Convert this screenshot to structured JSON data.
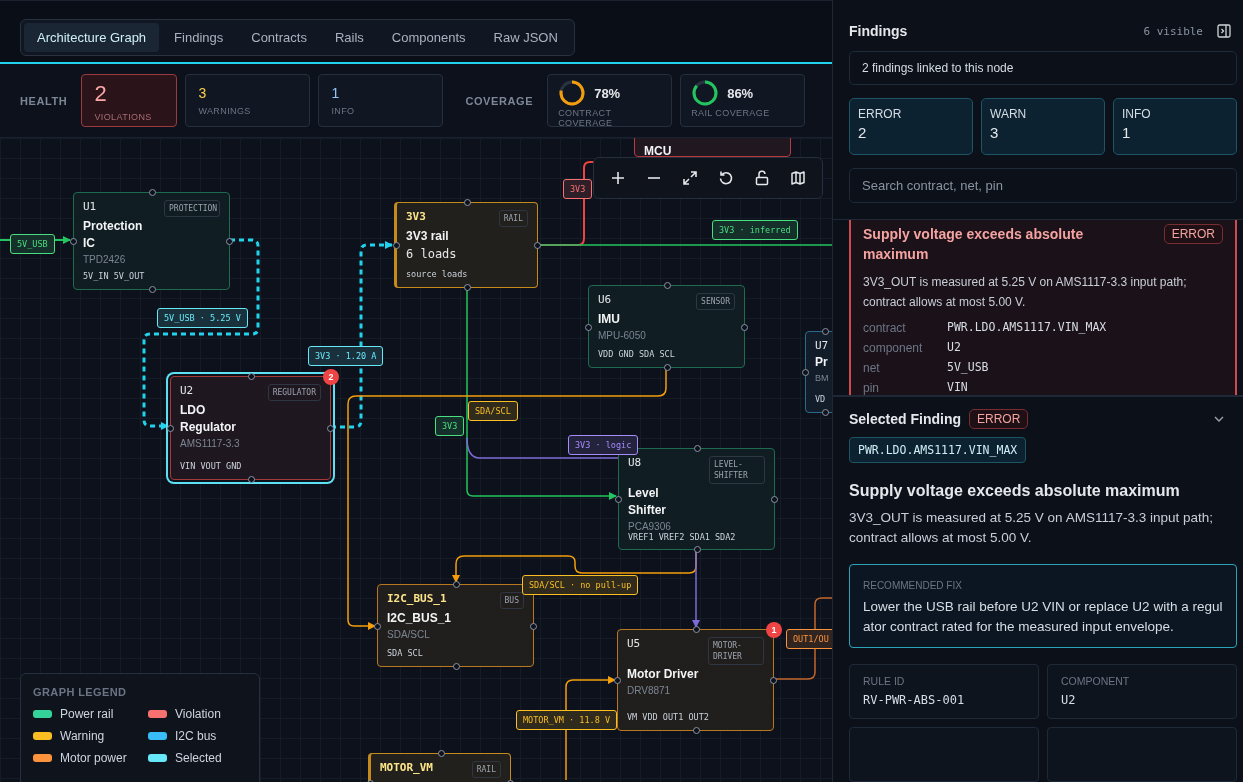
{
  "tabs": [
    {
      "label": "Architecture Graph",
      "selected": true
    },
    {
      "label": "Findings",
      "selected": false
    },
    {
      "label": "Contracts",
      "selected": false
    },
    {
      "label": "Rails",
      "selected": false
    },
    {
      "label": "Components",
      "selected": false
    },
    {
      "label": "Raw JSON",
      "selected": false
    }
  ],
  "health": {
    "label": "HEALTH",
    "cards": [
      {
        "kind": "violation",
        "value": "2",
        "label": "VIOLATIONS"
      },
      {
        "kind": "warning",
        "value": "3",
        "label": "WARNINGS"
      },
      {
        "kind": "info",
        "value": "1",
        "label": "INFO"
      }
    ]
  },
  "coverage": {
    "label": "COVERAGE",
    "cards": [
      {
        "value": "78%",
        "label": "CONTRACT COVERAGE",
        "color": "#f59e0b"
      },
      {
        "value": "86%",
        "label": "RAIL COVERAGE",
        "color": "#22c55e"
      }
    ]
  },
  "graph": {
    "nodes": [
      {
        "kind": "component",
        "color": "#b83a3f",
        "selected": false,
        "name": "MCU"
      },
      {
        "kind": "component",
        "color": "#1f6b4f",
        "selected": false,
        "ref": "U1",
        "type": "PROTECTION",
        "name": "Protection IC",
        "part": "TPD2426",
        "pins": "5V_IN 5V_OUT"
      },
      {
        "kind": "rail",
        "color": "#c48a1c",
        "selected": false,
        "ref": "3V3",
        "type": "RAIL",
        "name": "3V3 rail",
        "part": "6 loads",
        "pins": "source loads"
      },
      {
        "kind": "component",
        "color": "#1f6b4f",
        "selected": false,
        "ref": "U6",
        "type": "SENSOR",
        "name": "IMU",
        "part": "MPU-6050",
        "pins": "VDD GND SDA SCL"
      },
      {
        "kind": "component",
        "color": "#2b6a8f",
        "selected": false,
        "ref": "U7",
        "name": "Pr",
        "part": "BM",
        "pins": "VD"
      },
      {
        "kind": "component",
        "color": "#a33a3a",
        "selected": true,
        "ref": "U2",
        "type": "REGULATOR",
        "name": "LDO Regulator",
        "part": "AMS1117-3.3",
        "pins": "VIN VOUT GND",
        "badge": "2"
      },
      {
        "kind": "component",
        "color": "#1f6b4f",
        "selected": false,
        "ref": "U8",
        "type": "LEVEL-SHIFTER",
        "name": "Level Shifter",
        "part": "PCA9306",
        "pins": "VREF1 VREF2 SDA1 SDA2"
      },
      {
        "kind": "bus",
        "color": "#b7791f",
        "selected": false,
        "ref": "I2C_BUS_1",
        "type": "BUS",
        "name": "I2C_BUS_1",
        "part": "SDA/SCL",
        "pins": "SDA SCL"
      },
      {
        "kind": "component",
        "color": "#b7791f",
        "selected": false,
        "ref": "U5",
        "type": "MOTOR-DRIVER",
        "name": "Motor Driver",
        "part": "DRV8871",
        "pins": "VM VDD OUT1 OUT2",
        "badge": "1"
      },
      {
        "kind": "rail",
        "color": "#c48a1c",
        "selected": false,
        "ref": "MOTOR_VM",
        "type": "RAIL"
      }
    ],
    "edge_labels": [
      {
        "text": "5V_USB",
        "color": "#4ade80"
      },
      {
        "text": "5V_USB · 5.25 V",
        "color": "#67e8f9"
      },
      {
        "text": "3V3 · 1.20 A",
        "color": "#67e8f9"
      },
      {
        "text": "3V3",
        "color": "#f87171"
      },
      {
        "text": "3V3 · inferred",
        "color": "#4ade80"
      },
      {
        "text": "SDA/SCL",
        "color": "#fbbf24"
      },
      {
        "text": "3V3",
        "color": "#4ade80"
      },
      {
        "text": "3V3 · logic",
        "color": "#a78bfa"
      },
      {
        "text": "SDA/SCL · no pull-up",
        "color": "#fbbf24"
      },
      {
        "text": "OUT1/OU",
        "color": "#fb923c"
      },
      {
        "text": "MOTOR_VM · 11.8 V",
        "color": "#fbbf24"
      }
    ],
    "legend": {
      "title": "GRAPH LEGEND",
      "items": [
        {
          "label": "Power rail",
          "color": "#34d399"
        },
        {
          "label": "Violation",
          "color": "#f87171"
        },
        {
          "label": "Warning",
          "color": "#fbbf24"
        },
        {
          "label": "I2C bus",
          "color": "#38bdf8"
        },
        {
          "label": "Motor power",
          "color": "#fb923c"
        },
        {
          "label": "Selected",
          "color": "#67e8f9"
        }
      ]
    }
  },
  "findings": {
    "title": "Findings",
    "visible": "6 visible",
    "linked": "2 findings linked to this node",
    "counts": [
      {
        "label": "ERROR",
        "value": "2"
      },
      {
        "label": "WARN",
        "value": "3"
      },
      {
        "label": "INFO",
        "value": "1"
      }
    ],
    "search": {
      "placeholder": "Search contract, net, pin"
    },
    "card": {
      "title": "Supply voltage exceeds absolute maximum",
      "severity": "ERROR",
      "description": "3V3_OUT is measured at 5.25 V on AMS1117-3.3 input path; contract allows at most 5.00 V.",
      "fields": [
        {
          "key": "contract",
          "value": "PWR.LDO.AMS1117.VIN_MAX"
        },
        {
          "key": "component",
          "value": "U2"
        },
        {
          "key": "net",
          "value": "5V_USB"
        },
        {
          "key": "pin",
          "value": "VIN"
        }
      ]
    }
  },
  "selected_finding": {
    "title": "Selected Finding",
    "severity": "ERROR",
    "contract": "PWR.LDO.AMS1117.VIN_MAX",
    "heading": "Supply voltage exceeds absolute maximum",
    "description": "3V3_OUT is measured at 5.25 V on AMS1117-3.3 input path; contract allows at most 5.00 V.",
    "fix": {
      "label": "RECOMMENDED FIX",
      "text": "Lower the USB rail before U2 VIN or replace U2 with a regulator contract rated for the measured input envelope."
    },
    "meta": [
      {
        "label": "RULE ID",
        "value": "RV-PWR-ABS-001"
      },
      {
        "label": "COMPONENT",
        "value": "U2"
      }
    ]
  }
}
